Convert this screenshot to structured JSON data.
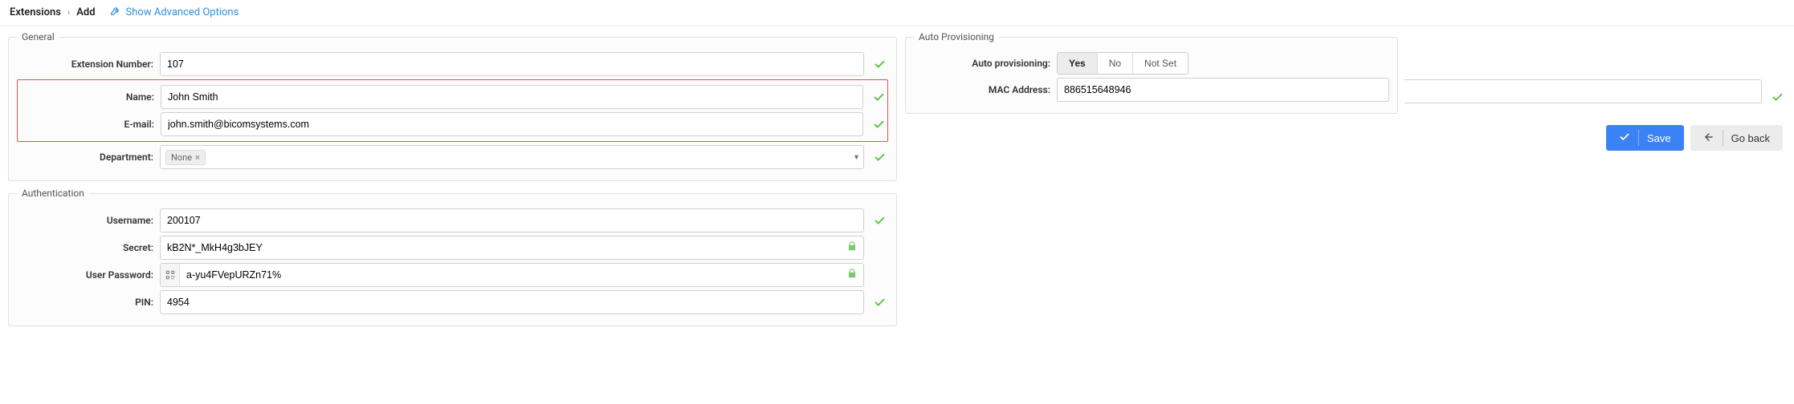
{
  "breadcrumb": {
    "root": "Extensions",
    "current": "Add"
  },
  "advanced_link": "Show Advanced Options",
  "panels": {
    "general": {
      "legend": "General",
      "extension_number": {
        "label": "Extension Number:",
        "value": "107"
      },
      "name": {
        "label": "Name:",
        "value": "John Smith"
      },
      "email": {
        "label": "E-mail:",
        "value": "john.smith@bicomsystems.com"
      },
      "department": {
        "label": "Department:",
        "chip": "None"
      }
    },
    "authentication": {
      "legend": "Authentication",
      "username": {
        "label": "Username:",
        "value": "200107"
      },
      "secret": {
        "label": "Secret:",
        "value": "kB2N*_MkH4g3bJEY"
      },
      "user_password": {
        "label": "User Password:",
        "value": "a-yu4FVepURZn71%"
      },
      "pin": {
        "label": "PIN:",
        "value": "4954"
      }
    },
    "autoprov": {
      "legend": "Auto Provisioning",
      "mode": {
        "label": "Auto provisioning:",
        "options": [
          "Yes",
          "No",
          "Not Set"
        ],
        "selected": "Yes"
      },
      "mac": {
        "label": "MAC Address:",
        "value": "886515648946"
      }
    }
  },
  "actions": {
    "save": "Save",
    "goback": "Go back"
  }
}
